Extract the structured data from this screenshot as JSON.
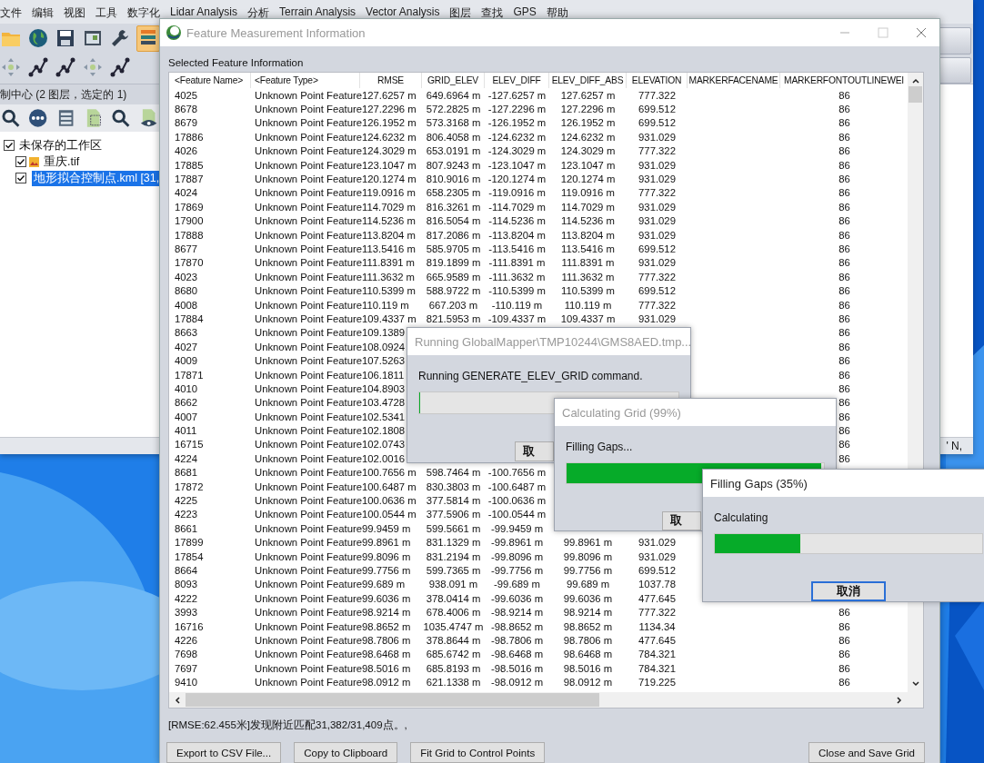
{
  "menu": [
    "文件",
    "编辑",
    "视图",
    "工具",
    "数字化",
    "Lidar Analysis",
    "分析",
    "Terrain Analysis",
    "Vector Analysis",
    "图层",
    "查找",
    "GPS",
    "帮助"
  ],
  "control_center": {
    "title": "制中心 (2 图层，选定的 1)",
    "tree": [
      {
        "label": "未保存的工作区",
        "checked": true,
        "selected": false,
        "children": [
          {
            "label": "重庆.tif",
            "kind": "raster",
            "checked": true,
            "selected": false
          },
          {
            "label": "地形拟合控制点.kml [31,",
            "kind": "vector",
            "checked": true,
            "selected": true
          }
        ]
      }
    ]
  },
  "status_bar": {
    "text": "' N,"
  },
  "feature_dialog": {
    "title": "Feature Measurement Information",
    "active": false,
    "section": "Selected Feature Information",
    "columns": [
      "<Feature Name>",
      "<Feature Type>",
      "RMSE",
      "GRID_ELEV",
      "ELEV_DIFF",
      "ELEV_DIFF_ABS",
      "ELEVATION",
      "MARKERFACENAME",
      "MARKERFONTOUTLINEWEI"
    ],
    "rows": [
      {
        "name": "4025",
        "type": "Unknown Point Feature",
        "rmse": "127.6257 m",
        "grid_elev": "649.6964 m",
        "elev_diff": "-127.6257 m",
        "elev_diff_abs": "127.6257 m",
        "elevation": "777.322",
        "outline_weight": "86"
      },
      {
        "name": "8678",
        "type": "Unknown Point Feature",
        "rmse": "127.2296 m",
        "grid_elev": "572.2825 m",
        "elev_diff": "-127.2296 m",
        "elev_diff_abs": "127.2296 m",
        "elevation": "699.512",
        "outline_weight": "86"
      },
      {
        "name": "8679",
        "type": "Unknown Point Feature",
        "rmse": "126.1952 m",
        "grid_elev": "573.3168 m",
        "elev_diff": "-126.1952 m",
        "elev_diff_abs": "126.1952 m",
        "elevation": "699.512",
        "outline_weight": "86"
      },
      {
        "name": "17886",
        "type": "Unknown Point Feature",
        "rmse": "124.6232 m",
        "grid_elev": "806.4058 m",
        "elev_diff": "-124.6232 m",
        "elev_diff_abs": "124.6232 m",
        "elevation": "931.029",
        "outline_weight": "86"
      },
      {
        "name": "4026",
        "type": "Unknown Point Feature",
        "rmse": "124.3029 m",
        "grid_elev": "653.0191 m",
        "elev_diff": "-124.3029 m",
        "elev_diff_abs": "124.3029 m",
        "elevation": "777.322",
        "outline_weight": "86"
      },
      {
        "name": "17885",
        "type": "Unknown Point Feature",
        "rmse": "123.1047 m",
        "grid_elev": "807.9243 m",
        "elev_diff": "-123.1047 m",
        "elev_diff_abs": "123.1047 m",
        "elevation": "931.029",
        "outline_weight": "86"
      },
      {
        "name": "17887",
        "type": "Unknown Point Feature",
        "rmse": "120.1274 m",
        "grid_elev": "810.9016 m",
        "elev_diff": "-120.1274 m",
        "elev_diff_abs": "120.1274 m",
        "elevation": "931.029",
        "outline_weight": "86"
      },
      {
        "name": "4024",
        "type": "Unknown Point Feature",
        "rmse": "119.0916 m",
        "grid_elev": "658.2305 m",
        "elev_diff": "-119.0916 m",
        "elev_diff_abs": "119.0916 m",
        "elevation": "777.322",
        "outline_weight": "86"
      },
      {
        "name": "17869",
        "type": "Unknown Point Feature",
        "rmse": "114.7029 m",
        "grid_elev": "816.3261 m",
        "elev_diff": "-114.7029 m",
        "elev_diff_abs": "114.7029 m",
        "elevation": "931.029",
        "outline_weight": "86"
      },
      {
        "name": "17900",
        "type": "Unknown Point Feature",
        "rmse": "114.5236 m",
        "grid_elev": "816.5054 m",
        "elev_diff": "-114.5236 m",
        "elev_diff_abs": "114.5236 m",
        "elevation": "931.029",
        "outline_weight": "86"
      },
      {
        "name": "17888",
        "type": "Unknown Point Feature",
        "rmse": "113.8204 m",
        "grid_elev": "817.2086 m",
        "elev_diff": "-113.8204 m",
        "elev_diff_abs": "113.8204 m",
        "elevation": "931.029",
        "outline_weight": "86"
      },
      {
        "name": "8677",
        "type": "Unknown Point Feature",
        "rmse": "113.5416 m",
        "grid_elev": "585.9705 m",
        "elev_diff": "-113.5416 m",
        "elev_diff_abs": "113.5416 m",
        "elevation": "699.512",
        "outline_weight": "86"
      },
      {
        "name": "17870",
        "type": "Unknown Point Feature",
        "rmse": "111.8391 m",
        "grid_elev": "819.1899 m",
        "elev_diff": "-111.8391 m",
        "elev_diff_abs": "111.8391 m",
        "elevation": "931.029",
        "outline_weight": "86"
      },
      {
        "name": "4023",
        "type": "Unknown Point Feature",
        "rmse": "111.3632 m",
        "grid_elev": "665.9589 m",
        "elev_diff": "-111.3632 m",
        "elev_diff_abs": "111.3632 m",
        "elevation": "777.322",
        "outline_weight": "86"
      },
      {
        "name": "8680",
        "type": "Unknown Point Feature",
        "rmse": "110.5399 m",
        "grid_elev": "588.9722 m",
        "elev_diff": "-110.5399 m",
        "elev_diff_abs": "110.5399 m",
        "elevation": "699.512",
        "outline_weight": "86"
      },
      {
        "name": "4008",
        "type": "Unknown Point Feature",
        "rmse": "110.119 m",
        "grid_elev": "667.203 m",
        "elev_diff": "-110.119 m",
        "elev_diff_abs": "110.119 m",
        "elevation": "777.322",
        "outline_weight": "86"
      },
      {
        "name": "17884",
        "type": "Unknown Point Feature",
        "rmse": "109.4337 m",
        "grid_elev": "821.5953 m",
        "elev_diff": "-109.4337 m",
        "elev_diff_abs": "109.4337 m",
        "elevation": "931.029",
        "outline_weight": "86"
      },
      {
        "name": "8663",
        "type": "Unknown Point Feature",
        "rmse": "109.1389",
        "outline_weight": "86"
      },
      {
        "name": "4027",
        "type": "Unknown Point Feature",
        "rmse": "108.0924",
        "outline_weight": "86"
      },
      {
        "name": "4009",
        "type": "Unknown Point Feature",
        "rmse": "107.5263",
        "outline_weight": "86"
      },
      {
        "name": "17871",
        "type": "Unknown Point Feature",
        "rmse": "106.1811",
        "outline_weight": "86"
      },
      {
        "name": "4010",
        "type": "Unknown Point Feature",
        "rmse": "104.8903",
        "outline_weight": "86"
      },
      {
        "name": "8662",
        "type": "Unknown Point Feature",
        "rmse": "103.4728",
        "outline_weight": "86"
      },
      {
        "name": "4007",
        "type": "Unknown Point Feature",
        "rmse": "102.5341",
        "outline_weight": "86"
      },
      {
        "name": "4011",
        "type": "Unknown Point Feature",
        "rmse": "102.1808",
        "outline_weight": "86"
      },
      {
        "name": "16715",
        "type": "Unknown Point Feature",
        "rmse": "102.0743",
        "outline_weight": "86"
      },
      {
        "name": "4224",
        "type": "Unknown Point Feature",
        "rmse": "102.0016",
        "outline_weight": "86"
      },
      {
        "name": "8681",
        "type": "Unknown Point Feature",
        "rmse": "100.7656 m",
        "grid_elev": "598.7464 m",
        "elev_diff": "-100.7656 m"
      },
      {
        "name": "17872",
        "type": "Unknown Point Feature",
        "rmse": "100.6487 m",
        "grid_elev": "830.3803 m",
        "elev_diff": "-100.6487 m"
      },
      {
        "name": "4225",
        "type": "Unknown Point Feature",
        "rmse": "100.0636 m",
        "grid_elev": "377.5814 m",
        "elev_diff": "-100.0636 m"
      },
      {
        "name": "4223",
        "type": "Unknown Point Feature",
        "rmse": "100.0544 m",
        "grid_elev": "377.5906 m",
        "elev_diff": "-100.0544 m"
      },
      {
        "name": "8661",
        "type": "Unknown Point Feature",
        "rmse": "99.9459 m",
        "grid_elev": "599.5661 m",
        "elev_diff": "-99.9459 m"
      },
      {
        "name": "17899",
        "type": "Unknown Point Feature",
        "rmse": "99.8961 m",
        "grid_elev": "831.1329 m",
        "elev_diff": "-99.8961 m",
        "elev_diff_abs": "99.8961 m",
        "elevation": "931.029"
      },
      {
        "name": "17854",
        "type": "Unknown Point Feature",
        "rmse": "99.8096 m",
        "grid_elev": "831.2194 m",
        "elev_diff": "-99.8096 m",
        "elev_diff_abs": "99.8096 m",
        "elevation": "931.029"
      },
      {
        "name": "8664",
        "type": "Unknown Point Feature",
        "rmse": "99.7756 m",
        "grid_elev": "599.7365 m",
        "elev_diff": "-99.7756 m",
        "elev_diff_abs": "99.7756 m",
        "elevation": "699.512"
      },
      {
        "name": "8093",
        "type": "Unknown Point Feature",
        "rmse": "99.689 m",
        "grid_elev": "938.091 m",
        "elev_diff": "-99.689 m",
        "elev_diff_abs": "99.689 m",
        "elevation": "1037.78"
      },
      {
        "name": "4222",
        "type": "Unknown Point Feature",
        "rmse": "99.6036 m",
        "grid_elev": "378.0414 m",
        "elev_diff": "-99.6036 m",
        "elev_diff_abs": "99.6036 m",
        "elevation": "477.645"
      },
      {
        "name": "3993",
        "type": "Unknown Point Feature",
        "rmse": "98.9214 m",
        "grid_elev": "678.4006 m",
        "elev_diff": "-98.9214 m",
        "elev_diff_abs": "98.9214 m",
        "elevation": "777.322",
        "outline_weight": "86"
      },
      {
        "name": "16716",
        "type": "Unknown Point Feature",
        "rmse": "98.8652 m",
        "grid_elev": "1035.4747 m",
        "elev_diff": "-98.8652 m",
        "elev_diff_abs": "98.8652 m",
        "elevation": "1134.34",
        "outline_weight": "86"
      },
      {
        "name": "4226",
        "type": "Unknown Point Feature",
        "rmse": "98.7806 m",
        "grid_elev": "378.8644 m",
        "elev_diff": "-98.7806 m",
        "elev_diff_abs": "98.7806 m",
        "elevation": "477.645",
        "outline_weight": "86"
      },
      {
        "name": "7698",
        "type": "Unknown Point Feature",
        "rmse": "98.6468 m",
        "grid_elev": "685.6742 m",
        "elev_diff": "-98.6468 m",
        "elev_diff_abs": "98.6468 m",
        "elevation": "784.321",
        "outline_weight": "86"
      },
      {
        "name": "7697",
        "type": "Unknown Point Feature",
        "rmse": "98.5016 m",
        "grid_elev": "685.8193 m",
        "elev_diff": "-98.5016 m",
        "elev_diff_abs": "98.5016 m",
        "elevation": "784.321",
        "outline_weight": "86"
      },
      {
        "name": "9410",
        "type": "Unknown Point Feature",
        "rmse": "98.0912 m",
        "grid_elev": "621.1338 m",
        "elev_diff": "-98.0912 m",
        "elev_diff_abs": "98.0912 m",
        "elevation": "719.225",
        "outline_weight": "86"
      }
    ],
    "message": "[RMSE:62.455米]发现附近匹配31,382/31,409点。,",
    "buttons": [
      "Export to CSV File...",
      "Copy to Clipboard",
      "Fit Grid to Control Points",
      "Close and Save Grid"
    ]
  },
  "progress_dialogs": [
    {
      "title": "Running GlobalMapper\\TMP10244\\GMS8AED.tmp...",
      "active": false,
      "message": "Running GENERATE_ELEV_GRID command.",
      "level": 0,
      "button": "取",
      "focused": false
    },
    {
      "title": "Calculating Grid (99%)",
      "active": false,
      "message": "Filling Gaps...",
      "level": 0.99,
      "button": "取",
      "focused": false
    },
    {
      "title": "Filling Gaps (35%)",
      "active": true,
      "message": "Calculating",
      "level": 0.32,
      "button": "取消",
      "focused": true
    }
  ]
}
